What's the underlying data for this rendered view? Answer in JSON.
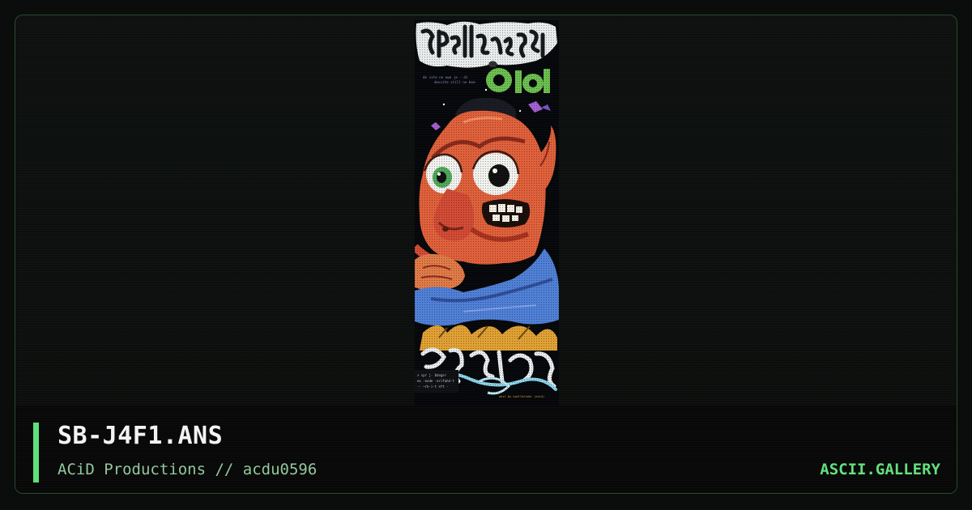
{
  "artwork": {
    "header_logo_text": "Spellbinder",
    "acid_logo_text": "acid",
    "tagline_lines": [
      "de site ne ewe je · di",
      "dessite still ne bee·"
    ],
    "side_credit": "spellbinder",
    "bottom_logo_text": "JOGL·J4F1",
    "small_text_lines": [
      "> spr j· bbeger",
      "  ex ·ende ·erifahd·t",
      "  ·· ~rk·i·t eft ·"
    ],
    "credit_line": "ansi by spellbinder (acid)"
  },
  "file": {
    "title": "SB-J4F1.ANS",
    "subtitle": "ACiD Productions // acdu0596"
  },
  "site": {
    "label": "ASCII.GALLERY"
  },
  "colors": {
    "accent": "#5ee07a",
    "background": "#0a0d0b",
    "border": "#2c4a30"
  }
}
